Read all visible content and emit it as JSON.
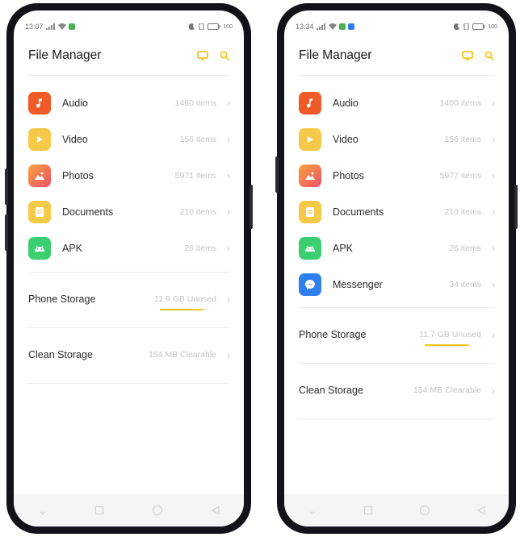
{
  "accent_color": "#f5c518",
  "phones": [
    {
      "status": {
        "time": "13:07",
        "battery": "100"
      },
      "title": "File Manager",
      "categories": [
        {
          "label": "Audio",
          "count": "1460 items",
          "icon": "music-note-icon",
          "color": "#f05a28"
        },
        {
          "label": "Video",
          "count": "156 items",
          "icon": "play-icon",
          "color": "#f7c948"
        },
        {
          "label": "Photos",
          "count": "5971 items",
          "icon": "image-icon",
          "color": "#f2655a"
        },
        {
          "label": "Documents",
          "count": "210 items",
          "icon": "document-icon",
          "color": "#f7c948"
        },
        {
          "label": "APK",
          "count": "26 items",
          "icon": "android-icon",
          "color": "#3ccf72"
        }
      ],
      "phone_storage": {
        "label": "Phone Storage",
        "value": "11.9 GB Unused",
        "used_fraction": 0.95
      },
      "clean_storage": {
        "label": "Clean Storage",
        "value": "154 MB Clearable"
      }
    },
    {
      "status": {
        "time": "13:34",
        "battery": "100"
      },
      "title": "File Manager",
      "categories": [
        {
          "label": "Audio",
          "count": "1400 items",
          "icon": "music-note-icon",
          "color": "#f05a28"
        },
        {
          "label": "Video",
          "count": "156 items",
          "icon": "play-icon",
          "color": "#f7c948"
        },
        {
          "label": "Photos",
          "count": "5977 items",
          "icon": "image-icon",
          "color": "#f2655a"
        },
        {
          "label": "Documents",
          "count": "210 items",
          "icon": "document-icon",
          "color": "#f7c948"
        },
        {
          "label": "APK",
          "count": "26 items",
          "icon": "android-icon",
          "color": "#3ccf72"
        },
        {
          "label": "Messenger",
          "count": "34 items",
          "icon": "messenger-icon",
          "color": "#2f80ed"
        }
      ],
      "phone_storage": {
        "label": "Phone Storage",
        "value": "11.7 GB Unused",
        "used_fraction": 0.95
      },
      "clean_storage": {
        "label": "Clean Storage",
        "value": "154 MB Clearable"
      }
    }
  ]
}
